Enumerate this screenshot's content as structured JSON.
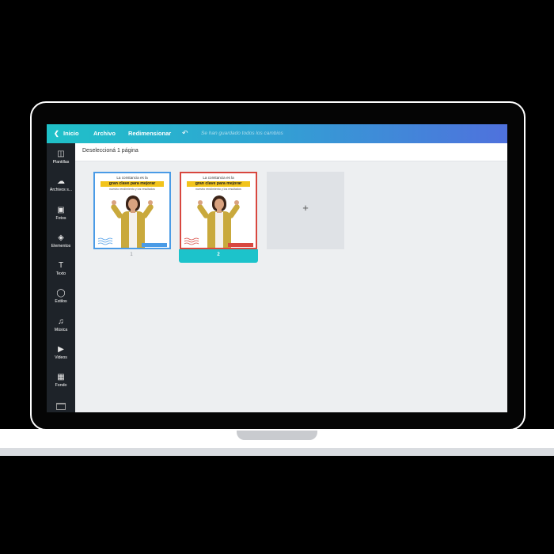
{
  "topbar": {
    "home_label": "Inicio",
    "file_label": "Archivo",
    "resize_label": "Redimensionar",
    "status_text": "Se han guardado todos los cambios"
  },
  "sidebar": {
    "items": [
      {
        "label": "Plantillas",
        "icon": "template-icon"
      },
      {
        "label": "Archivos s...",
        "icon": "cloud-upload-icon"
      },
      {
        "label": "Fotos",
        "icon": "image-icon"
      },
      {
        "label": "Elementos",
        "icon": "shapes-icon"
      },
      {
        "label": "Texto",
        "icon": "text-icon"
      },
      {
        "label": "Estilos",
        "icon": "palette-icon"
      },
      {
        "label": "Música",
        "icon": "music-icon"
      },
      {
        "label": "Videos",
        "icon": "video-icon"
      },
      {
        "label": "Fondo",
        "icon": "background-pattern-icon"
      }
    ]
  },
  "header": {
    "deselect_label": "Deseleccioná 1 página"
  },
  "pages": [
    {
      "number": "1",
      "line1": "La constancia es la",
      "highlight": "gran clave para mejorar",
      "line3": "nuestro rendimiento y los resultados"
    },
    {
      "number": "2",
      "line1": "La constancia es la",
      "highlight": "gran clave para mejorar",
      "line3": "nuestro rendimiento y los resultados"
    }
  ],
  "add_page": {
    "symbol": "+"
  },
  "colors": {
    "gradient_start": "#1fc1c8",
    "gradient_end": "#4f71dd",
    "selected_accent": "#1cc3cb",
    "page1_border": "#4a9be6",
    "page2_border": "#d8473f",
    "highlight_yellow": "#f2c41c"
  }
}
